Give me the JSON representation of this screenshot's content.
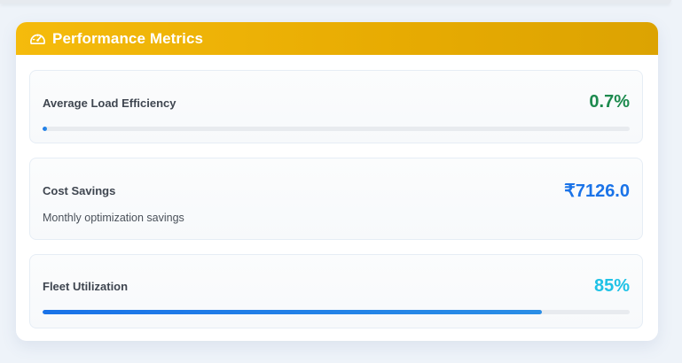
{
  "card": {
    "title": "Performance Metrics",
    "icon": "gauge-icon",
    "header_color": "#f5bb0c"
  },
  "metrics": [
    {
      "label": "Average Load Efficiency",
      "value": "0.7%",
      "value_color": "#1d8a4e",
      "progress": 0.007
    },
    {
      "label": "Cost Savings",
      "value": "₹7126.0",
      "subtext": "Monthly optimization savings",
      "value_color": "#1a73e8"
    },
    {
      "label": "Fleet Utilization",
      "value": "85%",
      "value_color": "#1fc2e6",
      "progress": 0.85
    }
  ]
}
